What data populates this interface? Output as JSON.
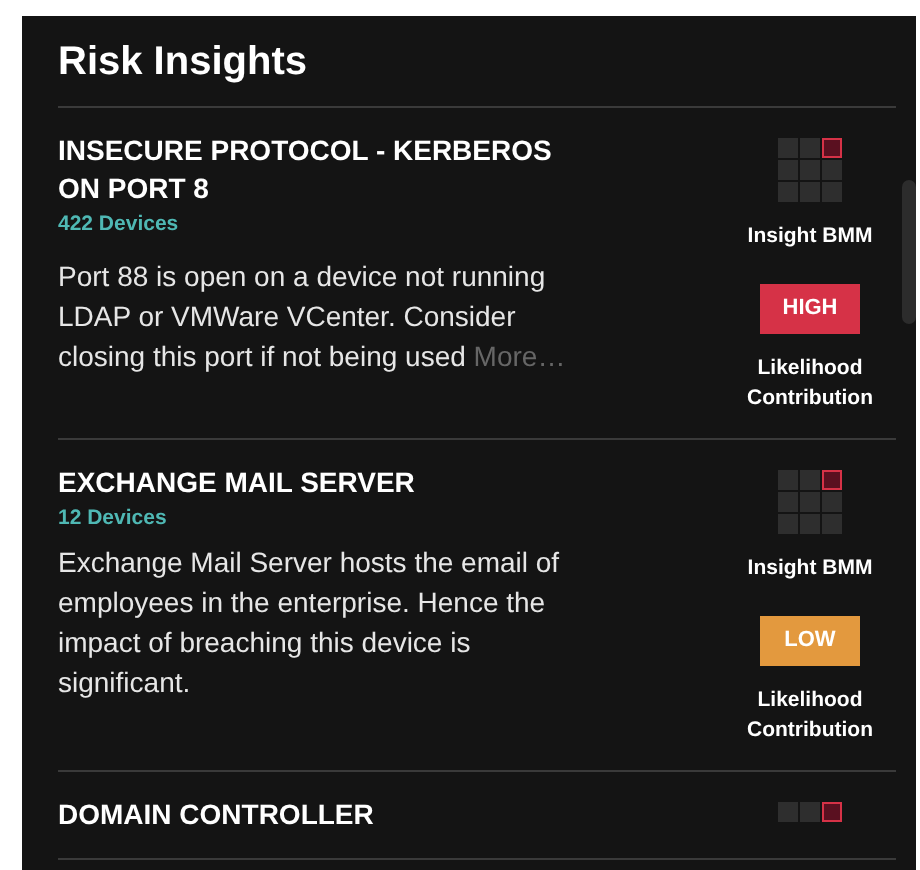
{
  "title": "Risk Insights",
  "insights": [
    {
      "title": "INSECURE PROTOCOL - KERBEROS ON PORT 8",
      "devices": "422 Devices",
      "description": "Port 88 is open on a device not running LDAP or VMWare VCenter. Consider closing this port if not being used",
      "more": "More…",
      "cells": [
        false,
        false,
        true,
        false,
        false,
        false,
        false,
        false,
        false
      ],
      "bmm_label": "Insight BMM",
      "likelihood": {
        "label": "HIGH",
        "color": "#d63247"
      },
      "likelihood_caption": "Likelihood Contribution"
    },
    {
      "title": "EXCHANGE MAIL SERVER",
      "devices": "12 Devices",
      "description": "Exchange Mail Server hosts the email of employees in the enterprise. Hence the impact of breaching this device is significant.",
      "cells": [
        false,
        false,
        true,
        false,
        false,
        false,
        false,
        false,
        false
      ],
      "bmm_label": "Insight BMM",
      "likelihood": {
        "label": "LOW",
        "color": "#e3993e"
      },
      "likelihood_caption": "Likelihood Contribution"
    },
    {
      "title": "DOMAIN CONTROLLER",
      "cells": [
        false,
        false,
        true
      ]
    }
  ]
}
